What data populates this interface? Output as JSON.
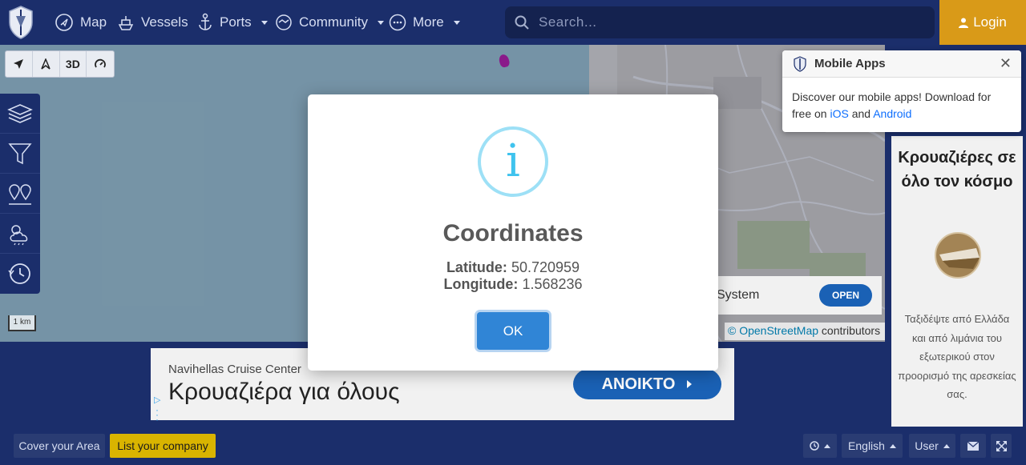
{
  "nav": {
    "items": [
      {
        "label": "Map",
        "icon": "compass-icon"
      },
      {
        "label": "Vessels",
        "icon": "ship-icon"
      },
      {
        "label": "Ports",
        "icon": "anchor-icon"
      },
      {
        "label": "Community",
        "icon": "handshake-icon"
      },
      {
        "label": "More",
        "icon": "more-dots-icon"
      }
    ],
    "search_placeholder": "Search...",
    "login_label": "Login"
  },
  "map_tools": {
    "threed_label": "3D"
  },
  "scale_label": "1 km",
  "attribution": {
    "link": "© OpenStreetMap",
    "text": " contributors"
  },
  "map_ad": {
    "text": "System",
    "button": "OPEN"
  },
  "mobile_popup": {
    "title": "Mobile Apps",
    "body": "Discover our mobile apps! Download for free on ",
    "ios": "iOS",
    "and": " and ",
    "android": "Android"
  },
  "right_ad": {
    "title": "Κρουαζιέρες σε όλο τον κόσμο",
    "description": "Ταξιδέψτε από Ελλάδα και από λιμάνια του εξωτερικού στον προορισμό της αρεσκείας σας."
  },
  "bottom_ad": {
    "advertiser": "Navihellas Cruise Center",
    "headline": "Κρουαζιέρα για όλους",
    "button": "ΑΝΟΙΚΤΟ"
  },
  "footer": {
    "cover_area": "Cover your Area",
    "list_company": "List your company",
    "language": "English",
    "user": "User"
  },
  "modal": {
    "title": "Coordinates",
    "latitude_label": "Latitude:",
    "latitude_value": "50.720959",
    "longitude_label": "Longitude:",
    "longitude_value": "1.568236",
    "ok_label": "OK"
  },
  "colors": {
    "navbar": "#1b2e6b",
    "login": "#d99a18",
    "modal_button": "#3085d6",
    "info_icon": "#3fc3ee",
    "list_company": "#d9b400"
  }
}
